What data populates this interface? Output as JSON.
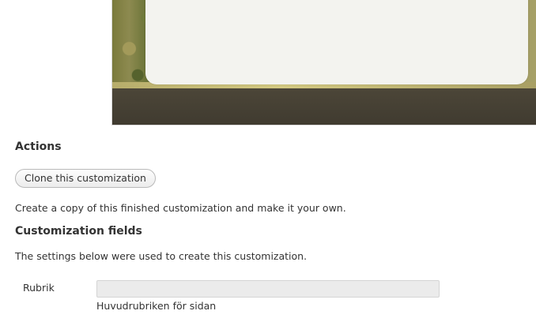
{
  "preview": {
    "image_name": "customization-preview-image"
  },
  "actions": {
    "title": "Actions",
    "clone_button": "Clone this customization",
    "description": "Create a copy of this finished customization and make it your own."
  },
  "fields": {
    "title": "Customization fields",
    "description": "The settings below were used to create this customization.",
    "items": [
      {
        "label": "Rubrik",
        "value": "",
        "help": "Huvudrubriken för sidan"
      }
    ]
  }
}
